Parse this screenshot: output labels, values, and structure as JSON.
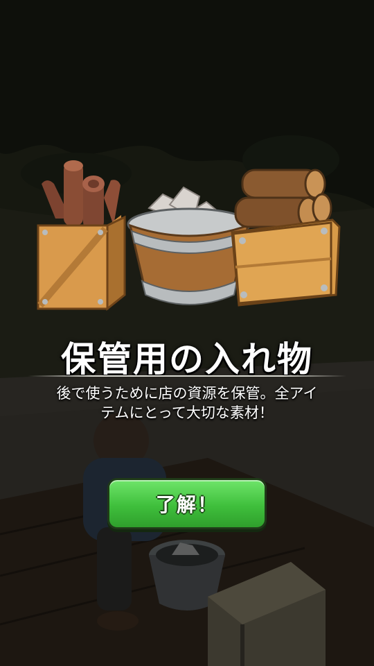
{
  "popup": {
    "title": "保管用の入れ物",
    "description_line1": "後で使うために店の資源を保管。全アイ",
    "description_line2": "テムにとって大切な素材！",
    "confirm_label": "了解！"
  },
  "rewards": [
    "leather-crate-icon",
    "stone-bucket-icon",
    "log-crate-icon"
  ],
  "colors": {
    "button_green": "#3fbf3c",
    "wood": "#c58a3e",
    "metal": "#9aa0a3"
  }
}
